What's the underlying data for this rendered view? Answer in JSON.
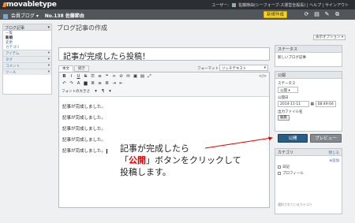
{
  "topbar": {
    "logo": "movabletype",
    "user_label": "ユーザー:",
    "user_name": "佐藤節由(シーフォーブ-ス運営全般長)",
    "help": "ヘルプ",
    "signout": "サインアウト"
  },
  "subbar": {
    "site": "会員ブログ",
    "entry_no": "No.138 佐藤節由",
    "new_button": "新規作成"
  },
  "sidebar": {
    "header": "ブログ記事",
    "items": [
      "一覧",
      "新規",
      "変更",
      "カテゴリ"
    ],
    "sections": [
      "アイテム",
      "タグ",
      "コメント",
      "ツール"
    ]
  },
  "page": {
    "title": "ブログ記事の作成",
    "display_options": "表示オプション ▾",
    "entry_title": "記事が完成したら投稿！"
  },
  "editor": {
    "tabs": [
      "本文",
      "続き"
    ],
    "format_label": "フォーマット",
    "format_value": "リッチテキスト",
    "font_size_label": "フォントの大きさ",
    "body_lines": [
      "記事が完成しました。",
      "記事が完成しました。",
      "記事が完成しました。",
      "記事が完成しました。",
      "記事が完成しました。"
    ]
  },
  "annotation": {
    "line1": "記事が完成したら",
    "line2_open": "「",
    "line2_bold": "公開",
    "line2_close": "」ボタンをクリックして",
    "line3": "投稿します。"
  },
  "status_panel": {
    "header": "ステータス",
    "value": "新しいブログ記事"
  },
  "publish_panel": {
    "header": "公開",
    "status_label": "ステータス",
    "status_value": "公開",
    "date_label": "公開日",
    "date_value": "2014-11-11",
    "time_value": "08:49:04",
    "filename_label": "出力ファイル名",
    "edit_button": "編集",
    "publish_button": "公開",
    "preview_button": "プレビュー"
  },
  "category_panel": {
    "header": "カテゴリ",
    "close": "閉じる",
    "add": "追加",
    "items": [
      "日記",
      "プロフィール"
    ],
    "footer": "選択されているカテゴリ"
  },
  "colors": {
    "topbar": "#2b2f33",
    "new_button": "#ffd71a",
    "publish": "#2a5d84",
    "annotation_red": "#e00000"
  }
}
